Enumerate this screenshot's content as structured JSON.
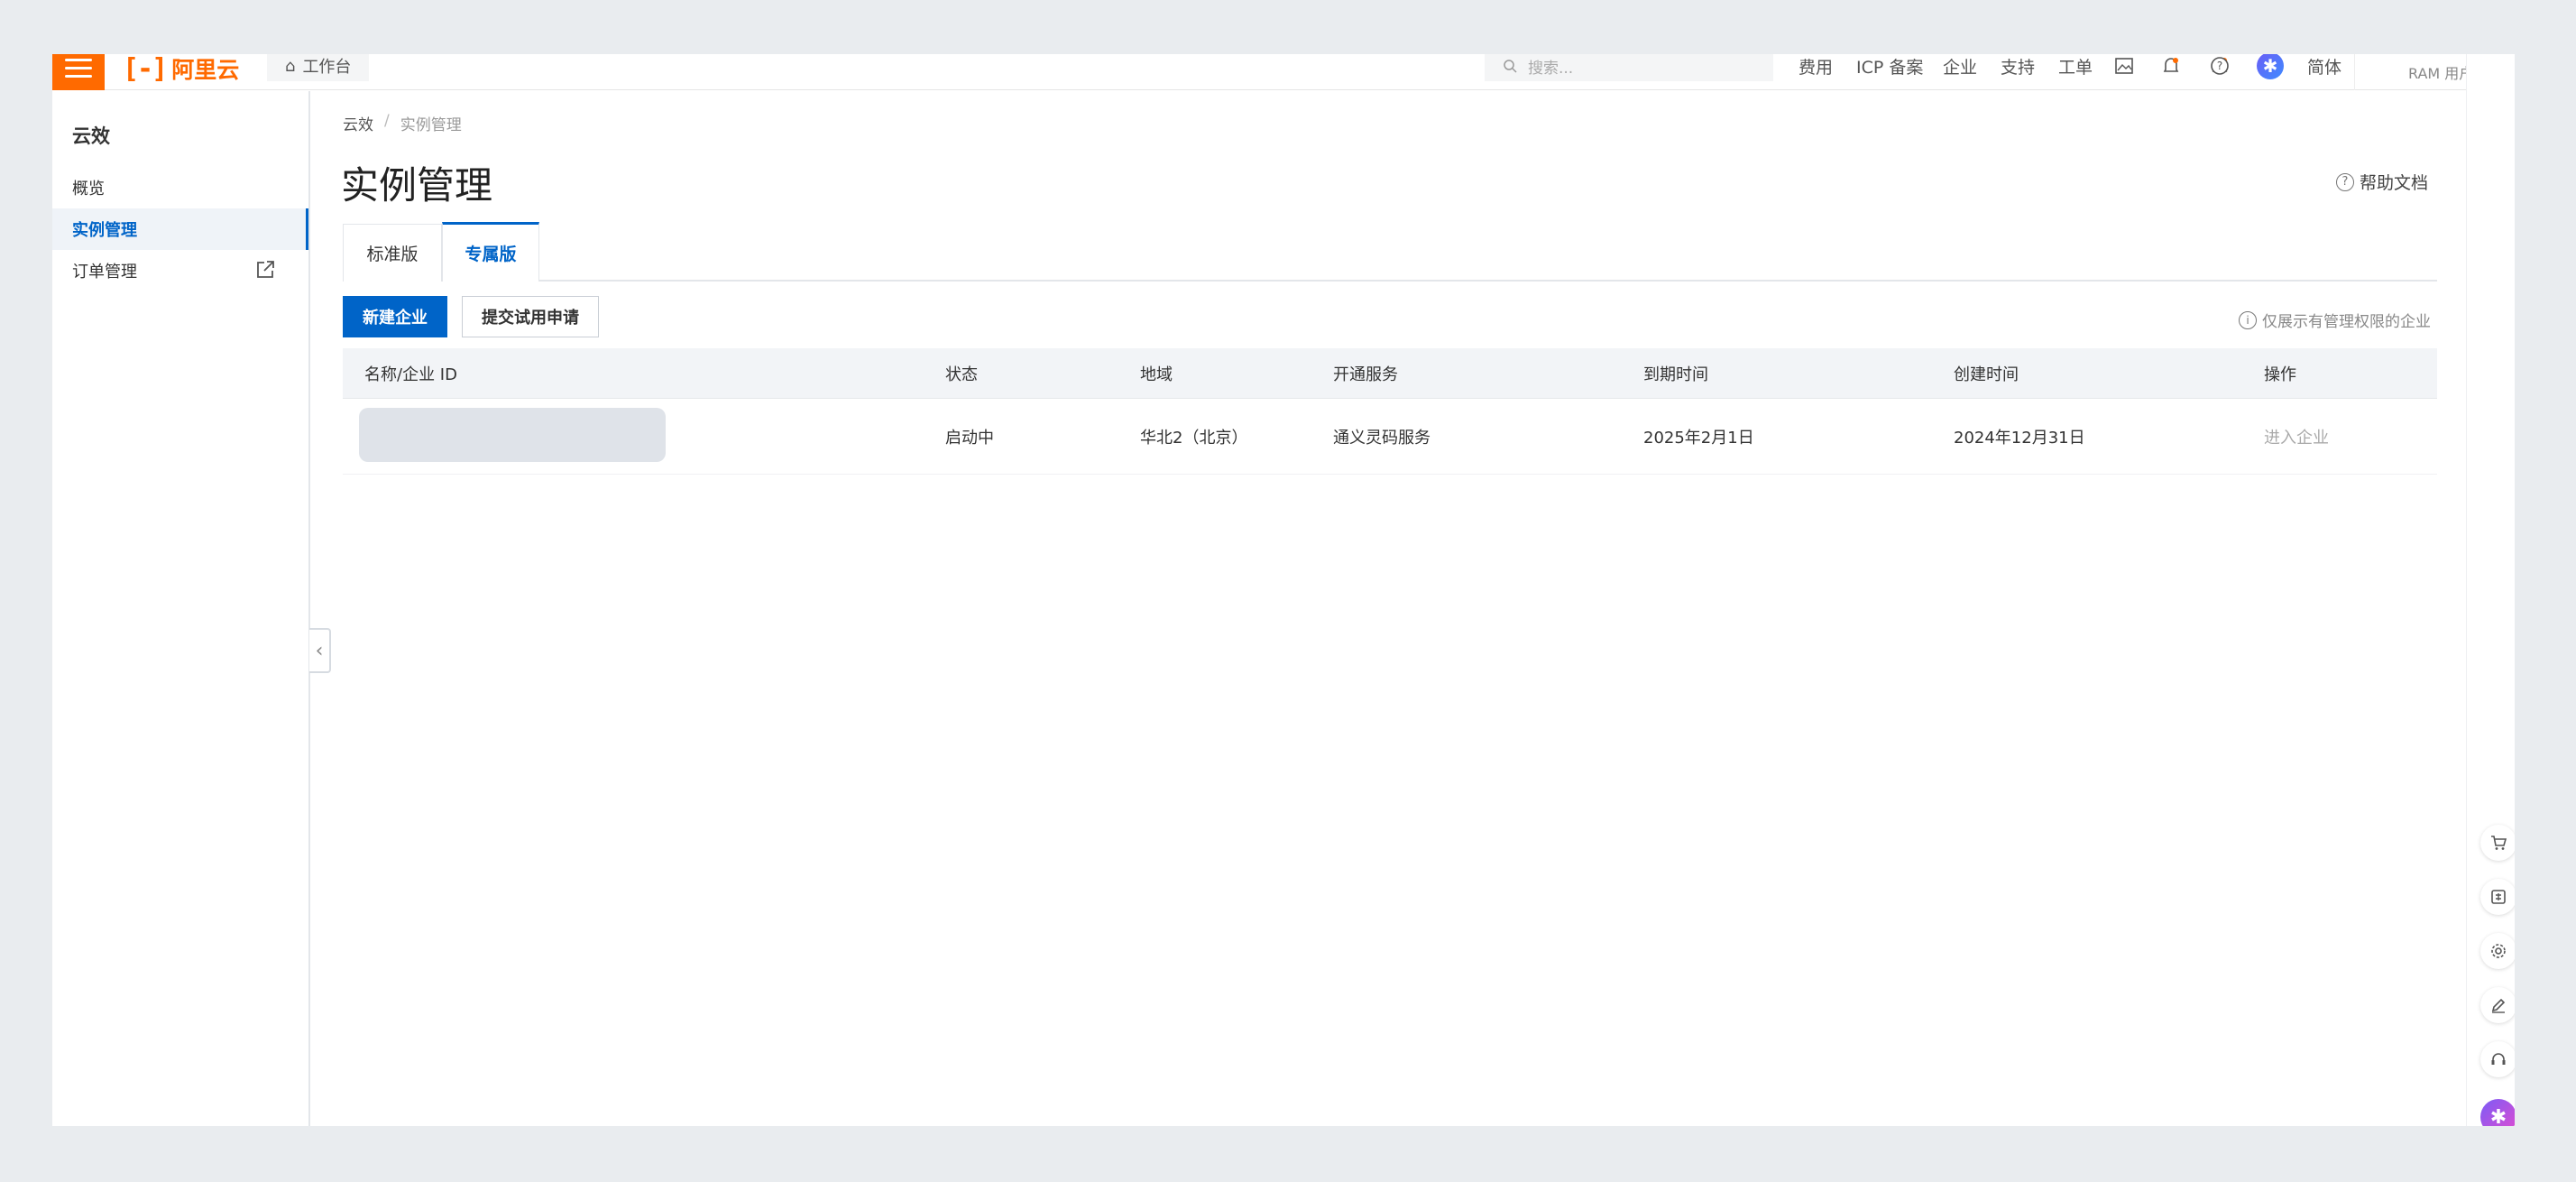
{
  "topbar": {
    "brand": "阿里云",
    "workbench": "工作台",
    "search_placeholder": "搜索...",
    "nav": [
      "费用",
      "ICP 备案",
      "企业",
      "支持",
      "工单"
    ],
    "lang": "简体",
    "ram_user": "RAM 用户"
  },
  "sidebar": {
    "title": "云效",
    "items": [
      {
        "label": "概览"
      },
      {
        "label": "实例管理"
      },
      {
        "label": "订单管理"
      }
    ]
  },
  "breadcrumb": {
    "root": "云效",
    "sep": "/",
    "current": "实例管理"
  },
  "page": {
    "title": "实例管理",
    "help": "帮助文档"
  },
  "tabs": [
    {
      "label": "标准版"
    },
    {
      "label": "专属版"
    }
  ],
  "actions": {
    "create": "新建企业",
    "trial": "提交试用申请",
    "perm_note": "仅展示有管理权限的企业"
  },
  "table": {
    "headers": [
      "名称/企业 ID",
      "状态",
      "地域",
      "开通服务",
      "到期时间",
      "创建时间",
      "操作"
    ],
    "rows": [
      {
        "status": "启动中",
        "region": "华北2（北京）",
        "service": "通义灵码服务",
        "expire": "2025年2月1日",
        "created": "2024年12月31日",
        "action": "进入企业"
      }
    ]
  },
  "colors": {
    "brand_orange": "#ff6a00",
    "primary_blue": "#0064c8"
  }
}
